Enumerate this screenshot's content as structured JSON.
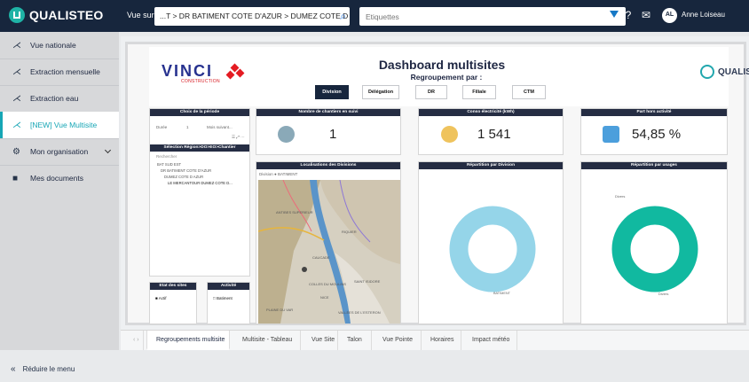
{
  "topbar": {
    "brand": "QUALISTEO",
    "view_label": "Vue sur",
    "path_value": "...T > DR BATIMENT COTE D'AZUR > DUMEZ COTE D AZUR",
    "tags_placeholder": "Etiquettes",
    "user_initials": "AL",
    "user_name": "Anne Loiseau"
  },
  "sidebar": {
    "items": [
      {
        "label": "Vue nationale"
      },
      {
        "label": "Extraction mensuelle"
      },
      {
        "label": "Extraction eau"
      },
      {
        "label": "[NEW] Vue Multisite"
      },
      {
        "label": "Mon organisation"
      },
      {
        "label": "Mes documents"
      }
    ],
    "collapse_label": "Réduire le menu"
  },
  "dashboard": {
    "brand_left_word": "VINCI",
    "brand_left_sub": "CONSTRUCTION",
    "title": "Dashboard multisites",
    "subtitle": "Regroupement par :",
    "groupings": [
      {
        "label": "Division"
      },
      {
        "label": "Délégation"
      },
      {
        "label": "DR"
      },
      {
        "label": "Filiale"
      },
      {
        "label": "CTM"
      }
    ],
    "brand_right": "QUALISTEO",
    "period_panel_title": "Choix de la période",
    "period_fields": [
      "Durée",
      "1",
      "Mois suivant..."
    ],
    "selection_title": "Sélection Région>DO>EO>Chantier",
    "selection_search": "Rechercher",
    "tree": [
      "BAT SUD EST",
      "DR BATIMENT COTE D'AZUR",
      "DUMEZ COTE D AZUR",
      "LE MERCANTOUR DUMEZ COTE D..."
    ],
    "status_title": "Etat des sites",
    "status_item": "Actif",
    "activity_title": "Activité",
    "activity_item": "Batiment",
    "kpis": [
      {
        "title": "Nombre de chantiers en suivi",
        "value": "1"
      },
      {
        "title": "Conso électricité (kWh)",
        "value": "1 541"
      },
      {
        "title": "Part hors activité",
        "value": "54,85 %"
      }
    ],
    "map": {
      "title": "Localisations des Divisions",
      "legend_label": "Division",
      "legend_value": "BATIMENT",
      "places": [
        "ANTIBES SUPERIEUR",
        "RIQUIER",
        "CAUCADE",
        "COLLES DU MOULINS",
        "NICE",
        "PLAINE DU VAR",
        "SAINT ISIDORE",
        "VALLÉES DE L'ESTERON"
      ]
    },
    "donut_division": {
      "title": "Répartition par Division",
      "label": "BATIMENT"
    },
    "donut_usage": {
      "title": "Répartition par usages",
      "top_label": "Divers",
      "bottom_label": "Divers"
    }
  },
  "tabs": [
    {
      "label": "Regroupements multisite"
    },
    {
      "label": "Multisite - Tableau"
    },
    {
      "label": "Vue Site"
    },
    {
      "label": "Talon"
    },
    {
      "label": "Vue Pointe"
    },
    {
      "label": "Horaires"
    },
    {
      "label": "Impact météo"
    }
  ],
  "colors": {
    "navy": "#17263d",
    "teal": "#16a6b5",
    "vinci_red": "#e41b22",
    "vinci_blue": "#27328f",
    "donut_blue": "#95d5e9",
    "donut_green": "#11b9a0"
  }
}
